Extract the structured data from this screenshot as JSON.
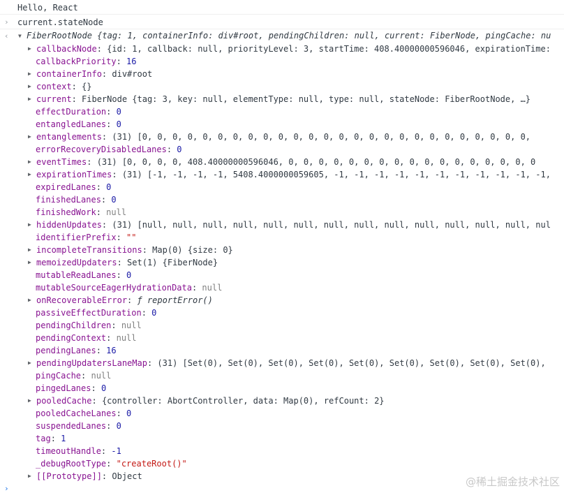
{
  "console": {
    "log_output": "Hello, React",
    "input_expression": "current.stateNode",
    "input_prompt_glyph": "›",
    "result_glyph": "‹",
    "bottom_prompt_glyph": "›",
    "root_summary_label": "FiberRootNode",
    "root_summary_body": "{tag: 1, containerInfo: div#root, pendingChildren: null, current: FiberNode, pingCache: nu",
    "properties": [
      {
        "key": "callbackNode",
        "sep": ": ",
        "value": "{id: 1, callback: null, priorityLevel: 3, startTime: 408.40000000596046, expirationTime:",
        "expandable": true
      },
      {
        "key": "callbackPriority",
        "sep": ": ",
        "value": "16",
        "expandable": false
      },
      {
        "key": "containerInfo",
        "sep": ": ",
        "value": "div#root",
        "expandable": true
      },
      {
        "key": "context",
        "sep": ": ",
        "value": "{}",
        "expandable": true
      },
      {
        "key": "current",
        "sep": ": ",
        "value": "FiberNode {tag: 3, key: null, elementType: null, type: null, stateNode: FiberRootNode, …}",
        "expandable": true
      },
      {
        "key": "effectDuration",
        "sep": ": ",
        "value": "0",
        "expandable": false
      },
      {
        "key": "entangledLanes",
        "sep": ": ",
        "value": "0",
        "expandable": false
      },
      {
        "key": "entanglements",
        "sep": ": ",
        "value": "(31) [0, 0, 0, 0, 0, 0, 0, 0, 0, 0, 0, 0, 0, 0, 0, 0, 0, 0, 0, 0, 0, 0, 0, 0, 0, 0,",
        "expandable": true
      },
      {
        "key": "errorRecoveryDisabledLanes",
        "sep": ": ",
        "value": "0",
        "expandable": false
      },
      {
        "key": "eventTimes",
        "sep": ": ",
        "value": "(31) [0, 0, 0, 0, 408.40000000596046, 0, 0, 0, 0, 0, 0, 0, 0, 0, 0, 0, 0, 0, 0, 0, 0, 0",
        "expandable": true
      },
      {
        "key": "expirationTimes",
        "sep": ": ",
        "value": "(31) [-1, -1, -1, -1, 5408.4000000059605, -1, -1, -1, -1, -1, -1, -1, -1, -1, -1, -1,",
        "expandable": true
      },
      {
        "key": "expiredLanes",
        "sep": ": ",
        "value": "0",
        "expandable": false
      },
      {
        "key": "finishedLanes",
        "sep": ": ",
        "value": "0",
        "expandable": false
      },
      {
        "key": "finishedWork",
        "sep": ": ",
        "value": "null",
        "expandable": false
      },
      {
        "key": "hiddenUpdates",
        "sep": ": ",
        "value": "(31) [null, null, null, null, null, null, null, null, null, null, null, null, null, nul",
        "expandable": true
      },
      {
        "key": "identifierPrefix",
        "sep": ": ",
        "value": "\"\"",
        "expandable": false
      },
      {
        "key": "incompleteTransitions",
        "sep": ": ",
        "value": "Map(0) {size: 0}",
        "expandable": true
      },
      {
        "key": "memoizedUpdaters",
        "sep": ": ",
        "value": "Set(1) {FiberNode}",
        "expandable": true
      },
      {
        "key": "mutableReadLanes",
        "sep": ": ",
        "value": "0",
        "expandable": false
      },
      {
        "key": "mutableSourceEagerHydrationData",
        "sep": ": ",
        "value": "null",
        "expandable": false
      },
      {
        "key": "onRecoverableError",
        "sep": ": ",
        "value": "ƒ reportError()",
        "expandable": true
      },
      {
        "key": "passiveEffectDuration",
        "sep": ": ",
        "value": "0",
        "expandable": false
      },
      {
        "key": "pendingChildren",
        "sep": ": ",
        "value": "null",
        "expandable": false
      },
      {
        "key": "pendingContext",
        "sep": ": ",
        "value": "null",
        "expandable": false
      },
      {
        "key": "pendingLanes",
        "sep": ": ",
        "value": "16",
        "expandable": false
      },
      {
        "key": "pendingUpdatersLaneMap",
        "sep": ": ",
        "value": "(31) [Set(0), Set(0), Set(0), Set(0), Set(0), Set(0), Set(0), Set(0), Set(0),",
        "expandable": true
      },
      {
        "key": "pingCache",
        "sep": ": ",
        "value": "null",
        "expandable": false
      },
      {
        "key": "pingedLanes",
        "sep": ": ",
        "value": "0",
        "expandable": false
      },
      {
        "key": "pooledCache",
        "sep": ": ",
        "value": "{controller: AbortController, data: Map(0), refCount: 2}",
        "expandable": true
      },
      {
        "key": "pooledCacheLanes",
        "sep": ": ",
        "value": "0",
        "expandable": false
      },
      {
        "key": "suspendedLanes",
        "sep": ": ",
        "value": "0",
        "expandable": false
      },
      {
        "key": "tag",
        "sep": ": ",
        "value": "1",
        "expandable": false
      },
      {
        "key": "timeoutHandle",
        "sep": ": ",
        "value": "-1",
        "expandable": false
      },
      {
        "key": "_debugRootType",
        "sep": ": ",
        "value": "\"createRoot()\"",
        "expandable": false
      },
      {
        "key": "[[Prototype]]",
        "sep": ": ",
        "value": "Object",
        "expandable": true
      }
    ]
  },
  "watermark": "@稀土掘金技术社区",
  "colors": {
    "key": "#881391",
    "number": "#1a1aa6",
    "string": "#c41a16",
    "null": "#808080"
  }
}
